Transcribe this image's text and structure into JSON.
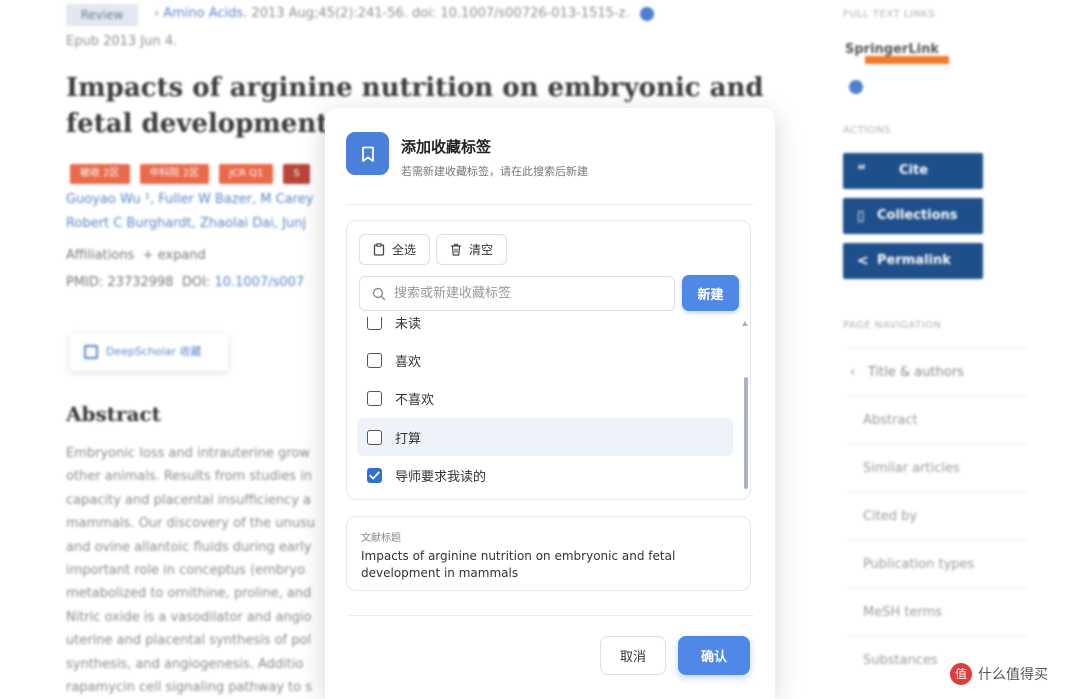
{
  "background": {
    "article_type": "Review",
    "journal_line": "Amino Acids. 2013 Aug;45(2):241-56. doi: 10.1007/s00726-013-1515-z.",
    "journal_name": "Amino Acids.",
    "journal_rest": "2013 Aug;45(2):241-56. doi: 10.1007/s00726-013-1515-z.",
    "epub": "Epub 2013 Jun 4.",
    "title": "Impacts of arginine nutrition on embryonic and fetal development in mammals",
    "tags": [
      "被收 2区",
      "中科院 2区",
      "JCR Q1",
      "S"
    ],
    "authors_line1": "Guoyao Wu ¹, Fuller W Bazer, M Carey",
    "authors_line2": "Robert C Burghardt, Zhaolai Dai, Junj",
    "affiliations": "Affiliations",
    "expand": "+ expand",
    "pmid_label": "PMID: 23732998",
    "doi_label": "DOI:",
    "doi_link": "10.1007/s007",
    "deepscholar": "DeepScholar 收藏",
    "abstract_heading": "Abstract",
    "abstract_lines": [
      "Embryonic loss and intrauterine grow",
      "other animals. Results from studies in",
      "capacity and placental insufficiency a",
      "mammals. Our discovery of the unusu",
      "and ovine allantoic fluids during early",
      "important role in conceptus (embryo",
      "metabolized to ornithine, proline, and",
      "Nitric oxide is a vasodilator and angio",
      "uterine and placental synthesis of pol",
      "synthesis, and angiogenesis. Additio",
      "rapamycin cell signaling pathway to s"
    ]
  },
  "sidebar": {
    "full_text_label": "FULL TEXT LINKS",
    "springer": "SpringerLink",
    "actions_label": "ACTIONS",
    "cite": "Cite",
    "collections": "Collections",
    "permalink": "Permalink",
    "page_nav_label": "PAGE NAVIGATION",
    "nav_items": [
      "Title & authors",
      "Abstract",
      "Similar articles",
      "Cited by",
      "Publication types",
      "MeSH terms",
      "Substances"
    ]
  },
  "dialog": {
    "title": "添加收藏标签",
    "subtitle": "若需新建收藏标签，请在此搜索后新建",
    "select_all": "全选",
    "clear": "清空",
    "search_placeholder": "搜索或新建收藏标签",
    "new_button": "新建",
    "tags": [
      {
        "label": "未读",
        "checked": false
      },
      {
        "label": "喜欢",
        "checked": false
      },
      {
        "label": "不喜欢",
        "checked": false
      },
      {
        "label": "打算",
        "checked": false,
        "highlighted": true
      },
      {
        "label": "导师要求我读的",
        "checked": true
      }
    ],
    "ref_label": "文献标题",
    "ref_title": "Impacts of arginine nutrition on embryonic and fetal development in mammals",
    "cancel": "取消",
    "confirm": "确认"
  },
  "watermark": {
    "logo": "值",
    "text": "什么值得买"
  },
  "colors": {
    "primary": "#4f88e6",
    "checkbox_checked": "#2f6fd8",
    "sidebar_button": "#1f4f8a",
    "tag_orange": "#e86a4b",
    "link_blue": "#5b86c7"
  }
}
